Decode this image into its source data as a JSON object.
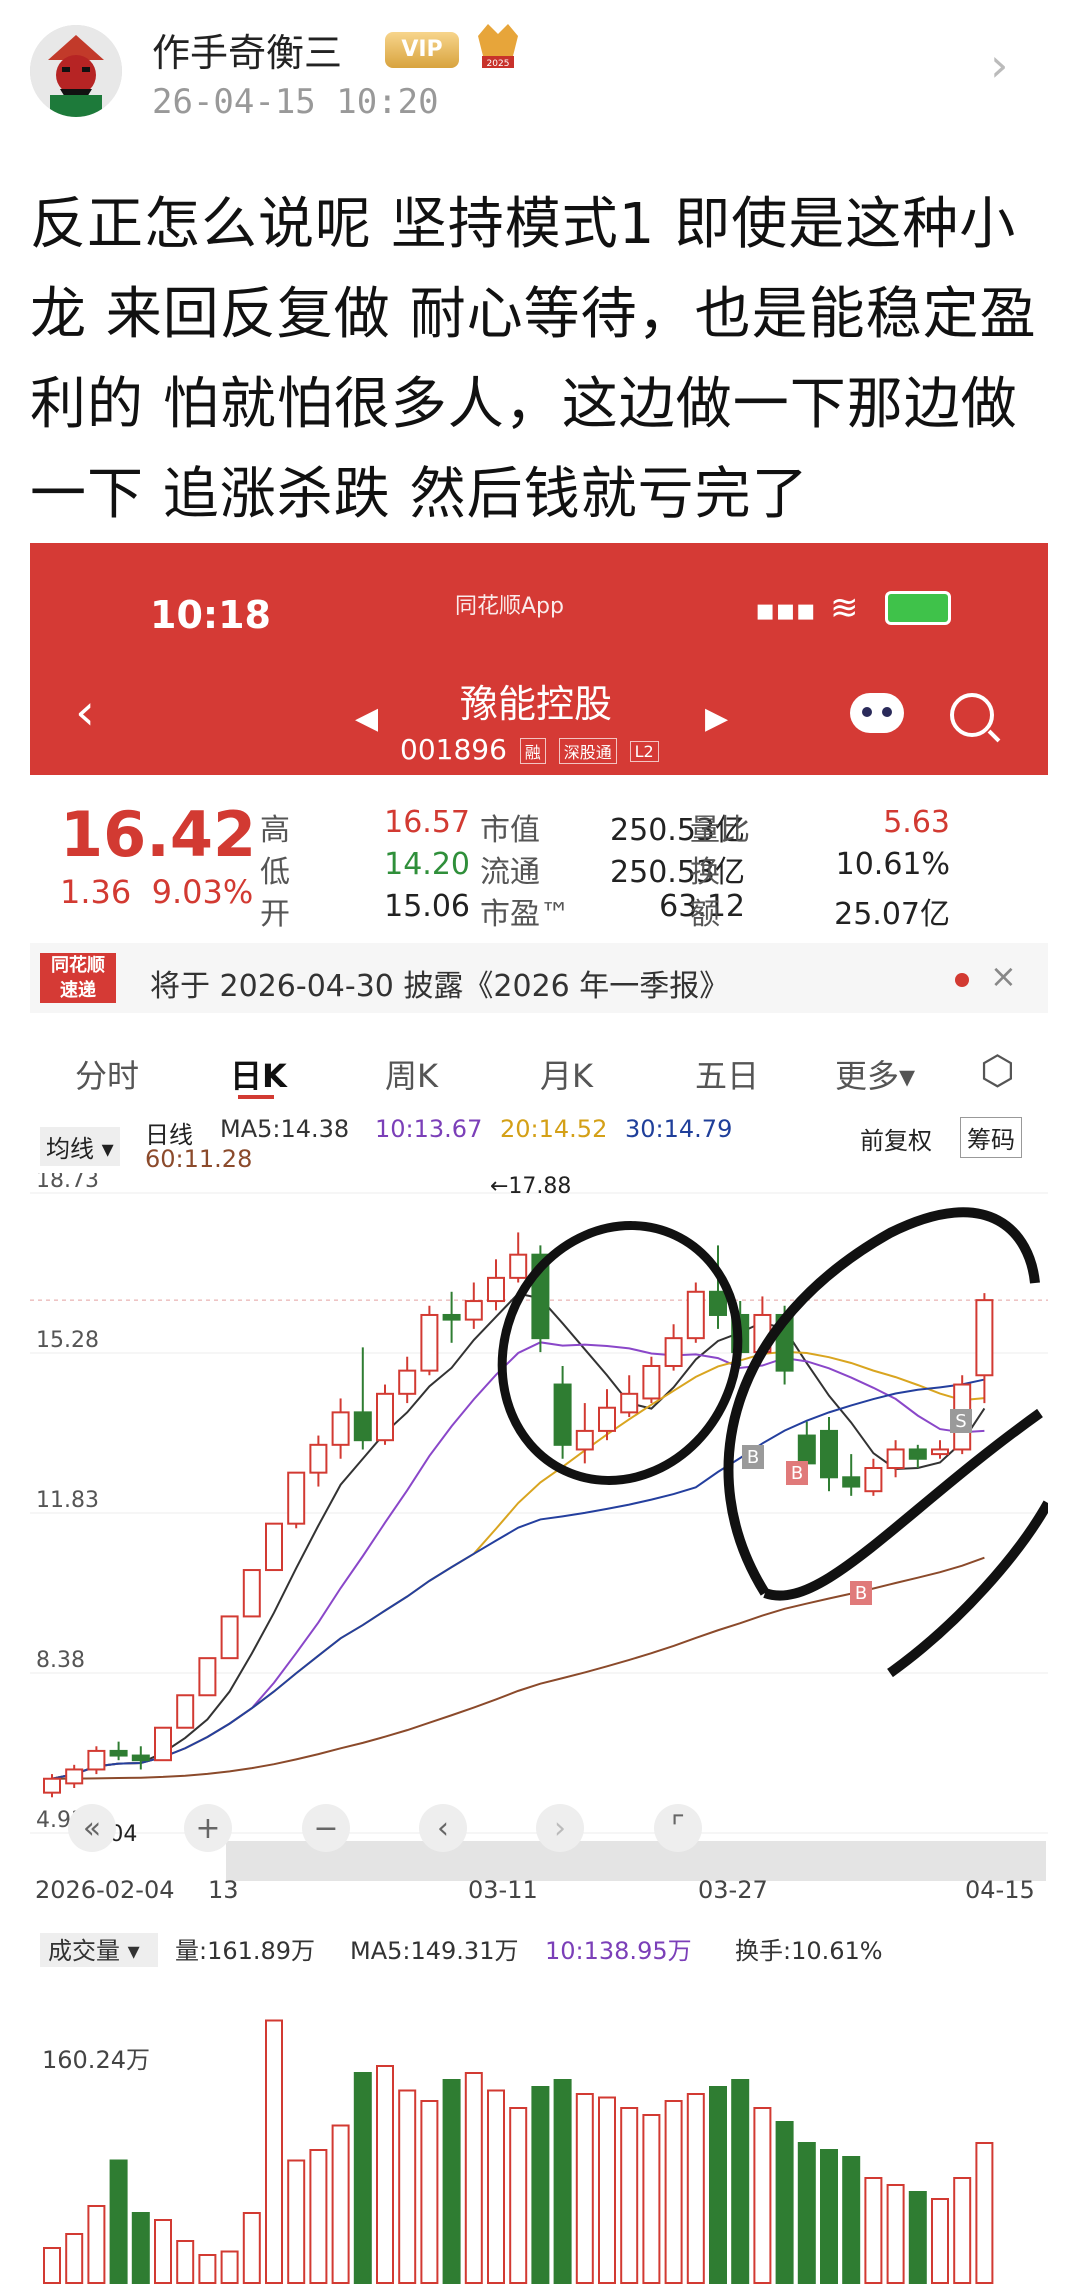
{
  "post": {
    "author": "作手奇衡三",
    "vip_badge": "VIP",
    "medal_text": "2025",
    "time": "26-04-15 10:20",
    "text": "反正怎么说呢 坚持模式1 即使是这种小龙 来回反复做 耐心等待，也是能稳定盈利的 怕就怕很多人，这边做一下那边做一下 追涨杀跌 然后钱就亏完了"
  },
  "app": {
    "status_time": "10:18",
    "app_name": "同花顺App",
    "stock_name": "豫能控股",
    "stock_code": "001896",
    "tags": [
      "融",
      "深股通",
      "L2"
    ],
    "accent": "#d53a35"
  },
  "quote": {
    "price": "16.42",
    "change": "1.36",
    "change_pct": "9.03%",
    "rows": [
      [
        {
          "l": "高",
          "v": "16.57",
          "c": "red"
        },
        {
          "l": "市值",
          "v": "250.53亿",
          "c": ""
        },
        {
          "l": "量比",
          "v": "5.63",
          "c": "red"
        }
      ],
      [
        {
          "l": "低",
          "v": "14.20",
          "c": "green"
        },
        {
          "l": "流通",
          "v": "250.53亿",
          "c": ""
        },
        {
          "l": "换",
          "v": "10.61%",
          "c": ""
        }
      ],
      [
        {
          "l": "开",
          "v": "15.06",
          "c": ""
        },
        {
          "l": "市盈™",
          "v": "63.12",
          "c": ""
        },
        {
          "l": "额",
          "v": "25.07亿",
          "c": ""
        }
      ]
    ]
  },
  "notice": {
    "logo1": "同花顺",
    "logo2": "速递",
    "text": "将于 2026-04-30 披露《2026 年一季报》"
  },
  "tabs": [
    "分时",
    "日K",
    "周K",
    "月K",
    "五日",
    "更多▾"
  ],
  "ma_row": {
    "dropdown": "均线 ▾",
    "period": "日线",
    "ma5": "MA5:14.38",
    "ma10": "10:13.67",
    "ma20": "20:14.52",
    "ma30": "30:14.79",
    "ma60": "60:11.28",
    "adjust": "前复权",
    "chips": "筹码"
  },
  "chart_data": {
    "type": "candlestick",
    "y_ticks": [
      "18.73",
      "15.28",
      "11.83",
      "8.38",
      "4.93"
    ],
    "high_label": "←17.88",
    "low_label": "←6.04",
    "x_labels": [
      "2026-02-04",
      "13",
      "03-11",
      "03-27",
      "04-15"
    ],
    "candles": [
      [
        5.8,
        6.1,
        5.7,
        6.2
      ],
      [
        6.0,
        6.3,
        5.9,
        6.4
      ],
      [
        6.3,
        6.7,
        6.2,
        6.8
      ],
      [
        6.7,
        6.6,
        6.5,
        6.9
      ],
      [
        6.6,
        6.5,
        6.3,
        6.8
      ],
      [
        6.5,
        7.2,
        6.5,
        7.2
      ],
      [
        7.2,
        7.9,
        7.2,
        7.9
      ],
      [
        7.9,
        8.7,
        7.9,
        8.7
      ],
      [
        8.7,
        9.6,
        8.7,
        9.6
      ],
      [
        9.6,
        10.6,
        9.6,
        10.6
      ],
      [
        10.6,
        11.6,
        10.6,
        11.6
      ],
      [
        11.6,
        12.7,
        11.5,
        12.7
      ],
      [
        12.7,
        13.3,
        12.4,
        13.5
      ],
      [
        13.3,
        14.0,
        13.0,
        14.3
      ],
      [
        14.0,
        13.4,
        13.2,
        15.4
      ],
      [
        13.4,
        14.4,
        13.3,
        14.6
      ],
      [
        14.4,
        14.9,
        14.2,
        15.2
      ],
      [
        14.9,
        16.1,
        14.8,
        16.3
      ],
      [
        16.1,
        16.0,
        15.5,
        16.6
      ],
      [
        16.0,
        16.4,
        15.8,
        16.8
      ],
      [
        16.4,
        16.9,
        16.2,
        17.3
      ],
      [
        16.9,
        17.4,
        16.8,
        17.88
      ],
      [
        17.4,
        15.6,
        15.3,
        17.6
      ],
      [
        14.6,
        13.3,
        13.0,
        15.0
      ],
      [
        13.2,
        13.6,
        12.9,
        14.2
      ],
      [
        13.6,
        14.1,
        13.4,
        14.5
      ],
      [
        14.0,
        14.4,
        13.9,
        14.8
      ],
      [
        14.3,
        15.0,
        14.2,
        15.2
      ],
      [
        15.0,
        15.6,
        14.9,
        15.9
      ],
      [
        15.6,
        16.6,
        15.5,
        16.8
      ],
      [
        16.6,
        16.1,
        15.8,
        17.6
      ],
      [
        16.1,
        15.3,
        15.0,
        16.4
      ],
      [
        15.3,
        16.1,
        15.2,
        16.5
      ],
      [
        16.1,
        14.9,
        14.6,
        16.3
      ],
      [
        13.5,
        12.9,
        12.6,
        13.8
      ],
      [
        13.6,
        12.6,
        12.3,
        13.9
      ],
      [
        12.6,
        12.4,
        12.2,
        13.1
      ],
      [
        12.3,
        12.8,
        12.2,
        13.0
      ],
      [
        12.8,
        13.2,
        12.6,
        13.4
      ],
      [
        13.2,
        13.0,
        12.8,
        13.3
      ],
      [
        13.1,
        13.2,
        13.0,
        13.4
      ],
      [
        13.2,
        14.6,
        13.1,
        14.8
      ],
      [
        14.8,
        16.42,
        14.2,
        16.57
      ]
    ],
    "volume": {
      "header": "成交量 ▾",
      "vol": "量:161.89万",
      "ma5": "MA5:149.31万",
      "ma10": "10:138.95万",
      "turnover": "换手:10.61%",
      "y_tick": "160.24万"
    }
  }
}
